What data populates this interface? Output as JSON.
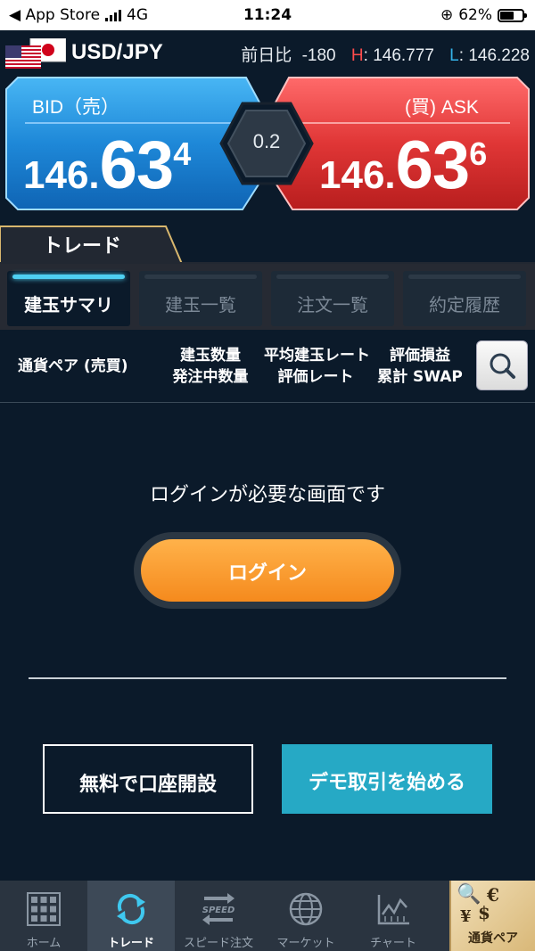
{
  "status_bar": {
    "back_label": "◀ App Store",
    "network": "4G",
    "time": "11:24",
    "battery": "62%",
    "battery_level": 0.62
  },
  "pair": {
    "name": "USD/JPY",
    "change_label": "前日比",
    "change_value": "-180",
    "high_label": "H",
    "high_value": "146.777",
    "low_label": "L",
    "low_value": "146.228"
  },
  "bid": {
    "label": "BID（売）",
    "price_small": "146.",
    "price_big": "63",
    "price_sup": "4",
    "color": "#1e88d8"
  },
  "ask": {
    "label": "(買) ASK",
    "price_small": "146.",
    "price_big": "63",
    "price_sup": "6",
    "color": "#e03636"
  },
  "spread": "0.2",
  "trade_tab": "トレード",
  "tabs": [
    {
      "label": "建玉サマリ",
      "active": true
    },
    {
      "label": "建玉一覧",
      "active": false
    },
    {
      "label": "注文一覧",
      "active": false
    },
    {
      "label": "約定履歴",
      "active": false
    }
  ],
  "columns": {
    "pair": "通貨ペア (売買)",
    "qty1": "建玉数量",
    "qty2": "発注中数量",
    "rate1": "平均建玉レート",
    "rate2": "評価レート",
    "pl1": "評価損益",
    "pl2": "累計 SWAP"
  },
  "content": {
    "message": "ログインが必要な画面です",
    "login_button": "ログイン",
    "open_account_button": "無料で口座開設",
    "demo_button": "デモ取引を始める"
  },
  "nav": [
    {
      "label": "ホーム",
      "icon": "grid-icon",
      "active": false
    },
    {
      "label": "トレード",
      "icon": "refresh-arrows-icon",
      "active": true
    },
    {
      "label": "スピード注文",
      "icon": "speed-arrows-icon",
      "active": false
    },
    {
      "label": "マーケット",
      "icon": "globe-icon",
      "active": false
    },
    {
      "label": "チャート",
      "icon": "chart-icon",
      "active": false
    },
    {
      "label": "通貨ペア",
      "icon": "currency-icon",
      "active": false
    }
  ]
}
